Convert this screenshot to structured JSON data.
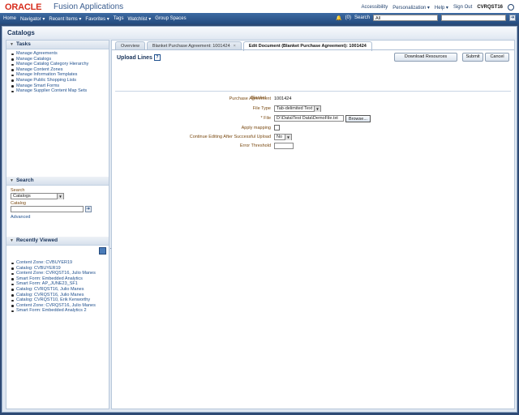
{
  "brand": {
    "oracle": "ORACLE",
    "app": "Fusion Applications"
  },
  "top_links": {
    "accessibility": "Accessibility",
    "personalization": "Personalization ▾",
    "help": "Help ▾",
    "signout": "Sign Out",
    "user": "CVRQST16"
  },
  "nav": {
    "items": [
      "Home",
      "Navigator ▾",
      "Recent Items ▾",
      "Favorites ▾",
      "Tags",
      "Watchlist ▾",
      "Group Spaces"
    ],
    "notif": "(0)",
    "search_label": "Search",
    "search_scope": "All"
  },
  "page_title": "Catalogs",
  "tasks": {
    "header": "Tasks",
    "links": [
      "Manage Agreements",
      "Manage Catalogs",
      "Manage Catalog Category Hierarchy",
      "Manage Content Zones",
      "Manage Information Templates",
      "Manage Public Shopping Lists",
      "Manage Smart Forms",
      "Manage Supplier Content Map Sets"
    ]
  },
  "search_panel": {
    "header": "Search",
    "search_label": "Search",
    "search_value": "Catalogs",
    "catalog_label": "Catalog",
    "advanced": "Advanced"
  },
  "recent": {
    "header": "Recently Viewed",
    "items": [
      "Content Zone: CVBUYER19",
      "Catalog: CVBUYER19",
      "Content Zone: CVRQST16, Julio Manes",
      "Smart Form: Embedded Analytics",
      "Smart Form: AP_JUNE23_SF1",
      "Catalog: CVRQST16, Julio Manes",
      "Catalog: CVRQST16, Julio Manes",
      "Catalog: CVRQST10, Erik Kenworthy",
      "Content Zone: CVRQST16, Julio Manes",
      "Smart Form: Embedded Analytics 2"
    ]
  },
  "tabs": [
    {
      "label": "Overview"
    },
    {
      "label": "Blanket Purchase Agreement: 1001424"
    },
    {
      "label": "Edit Document (Blanket Purchase Agreement): 1001424"
    }
  ],
  "upload": {
    "title": "Upload Lines",
    "help_glyph": "?",
    "buttons": {
      "download": "Download Resources",
      "submit": "Submit",
      "cancel": "Cancel"
    },
    "blanket": "Blanket",
    "fields": {
      "agreement_label": "Purchase Agreement",
      "agreement_value": "1001424",
      "file_type_label": "File Type",
      "file_type_value": "Tab-delimited Text",
      "file_label": "* File",
      "file_value": "D:\\Data\\Test Data\\DemoFile.txt",
      "browse": "Browse...",
      "apply_mapping_label": "Apply mapping",
      "continue_label": "Continue Editing After Successful Upload",
      "continue_value": "No",
      "error_threshold_label": "Error Threshold",
      "error_threshold_value": ""
    }
  }
}
